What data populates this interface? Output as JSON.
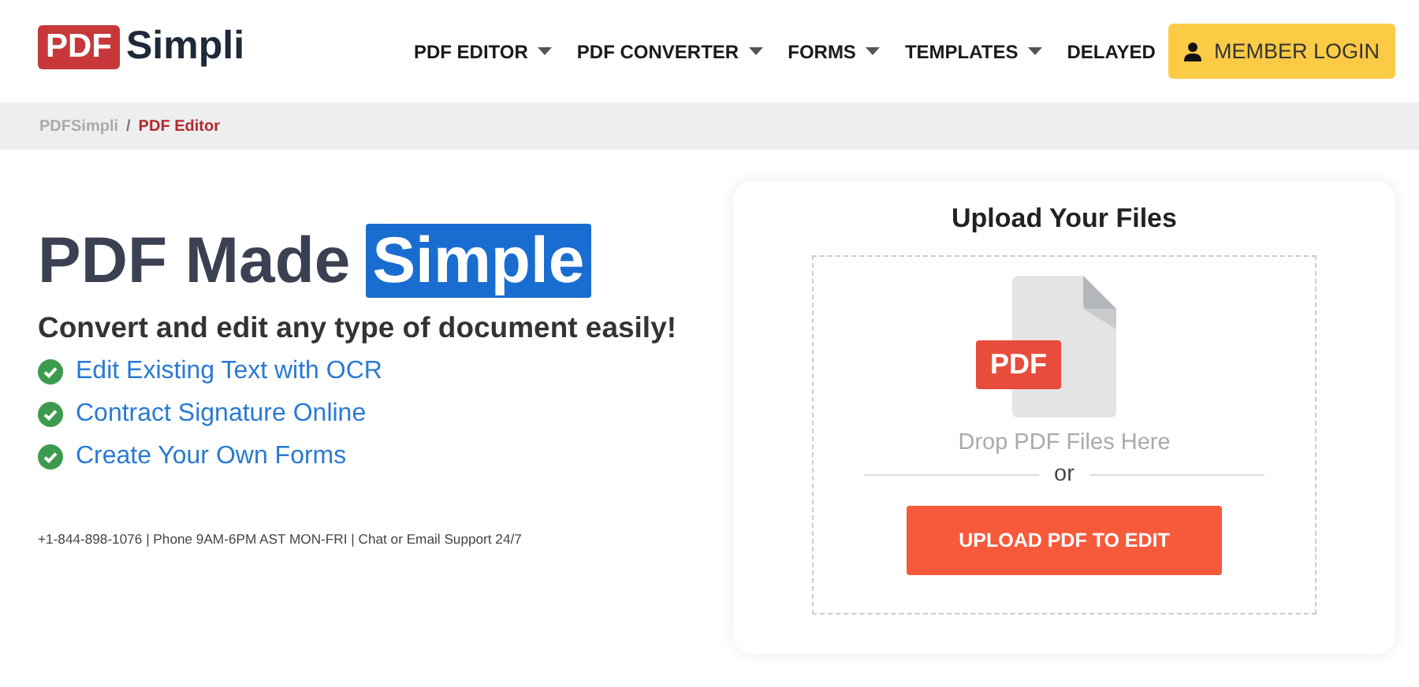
{
  "logo": {
    "badge": "PDF",
    "name": "Simpli"
  },
  "nav": [
    {
      "label": "PDF EDITOR",
      "has_dropdown": true
    },
    {
      "label": "PDF CONVERTER",
      "has_dropdown": true
    },
    {
      "label": "FORMS",
      "has_dropdown": true
    },
    {
      "label": "TEMPLATES",
      "has_dropdown": true
    },
    {
      "label": "DELAYED",
      "has_dropdown": false
    }
  ],
  "login_button": "MEMBER LOGIN",
  "breadcrumb": [
    {
      "label": "PDFSimpli",
      "selected": false
    },
    {
      "label": "PDF Editor",
      "selected": true
    }
  ],
  "breadcrumb_separator": "/",
  "hero": {
    "heading": "PDF Made",
    "heading_highlight": "Simple",
    "subheading": "Convert and edit any type of document easily!",
    "features": [
      "Edit Existing Text with OCR",
      "Contract Signature Online",
      "Create Your Own Forms"
    ],
    "contact": "+1-844-898-1076 | Phone 9AM-6PM AST MON-FRI | Chat or Email Support 24/7"
  },
  "upload": {
    "title": "Upload Your Files",
    "file_badge": "PDF",
    "drop_text": "Drop PDF Files Here",
    "divider_text": "or",
    "button": "UPLOAD PDF TO EDIT"
  }
}
